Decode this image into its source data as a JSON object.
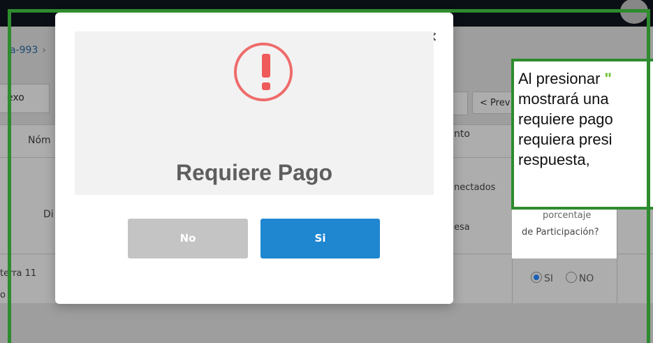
{
  "background": {
    "breadcrumb": "a-993",
    "breadcrumb_sep": "›",
    "annex_tab": "exo",
    "prev_button": "< Prev",
    "table": {
      "header_name": "Nóm",
      "header_amount": "nto",
      "header_connected": "nectados",
      "row_label_di": "Di",
      "row_label_esa": "esa",
      "row_address_line1": "terra 11",
      "row_address_line2": "o",
      "participation_line1": "porcentaje",
      "participation_line2": "de Participación?",
      "radio_si": "SI",
      "radio_no": "NO"
    }
  },
  "modal": {
    "close": "×",
    "title": "Requiere Pago",
    "no_label": "No",
    "si_label": "Si",
    "icon": "exclamation-circle-icon"
  },
  "callout": {
    "prefix": "Al presionar ",
    "quote": "\"",
    "line2": "mostrará una",
    "line3": "requiere pago",
    "line4": "requiera presi",
    "line5": "respuesta,"
  },
  "colors": {
    "frame": "#2e8b2e",
    "warning": "#ef6b6b",
    "primary_button": "#1f86d0",
    "secondary_button": "#c4c4c4"
  }
}
